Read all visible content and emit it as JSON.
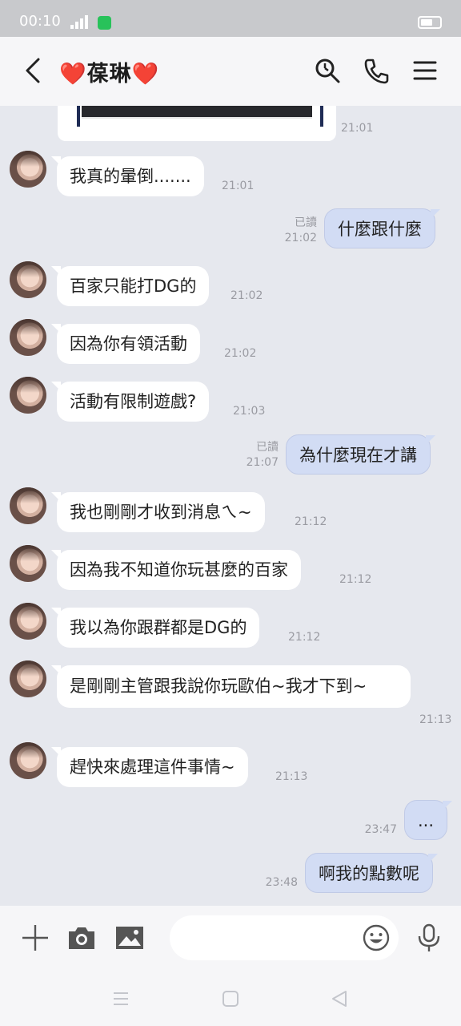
{
  "status_bar": {
    "time": "00:10"
  },
  "header": {
    "title": "❤️葆琳❤️"
  },
  "messages": [
    {
      "id": "m0",
      "meta_time": "21:01"
    },
    {
      "id": "m1",
      "text": "我真的暈倒.......",
      "time": "21:01"
    },
    {
      "id": "m2",
      "text": "什麼跟什麼",
      "read": "已讀",
      "time": "21:02"
    },
    {
      "id": "m3",
      "text": "百家只能打DG的",
      "time": "21:02"
    },
    {
      "id": "m4",
      "text": "因為你有領活動",
      "time": "21:02"
    },
    {
      "id": "m5",
      "text": "活動有限制遊戲?",
      "time": "21:03"
    },
    {
      "id": "m6",
      "text": "為什麼現在才講",
      "read": "已讀",
      "time": "21:07"
    },
    {
      "id": "m7",
      "text": "我也剛剛才收到消息ㄟ~",
      "time": "21:12"
    },
    {
      "id": "m8",
      "text": "因為我不知道你玩甚麼的百家",
      "time": "21:12"
    },
    {
      "id": "m9",
      "text": "我以為你跟群都是DG的",
      "time": "21:12"
    },
    {
      "id": "m10",
      "text": "是剛剛主管跟我說你玩歐伯~我才下到~",
      "time": "21:13"
    },
    {
      "id": "m11",
      "text": "趕快來處理這件事情~",
      "time": "21:13"
    },
    {
      "id": "m12",
      "text": "...",
      "time": "23:47"
    },
    {
      "id": "m13",
      "text": "啊我的點數呢",
      "time": "23:48"
    }
  ],
  "input": {
    "placeholder": ""
  },
  "icons": {
    "back": "back-arrow-icon",
    "search": "search-icon",
    "call": "phone-icon",
    "menu": "menu-icon",
    "plus": "plus-icon",
    "camera": "camera-icon",
    "image": "image-icon",
    "emoji": "emoji-icon",
    "mic": "microphone-icon"
  },
  "colors": {
    "incoming_bubble": "#ffffff",
    "outgoing_bubble": "#d2dcf4",
    "chat_bg": "#e6e8ee"
  }
}
